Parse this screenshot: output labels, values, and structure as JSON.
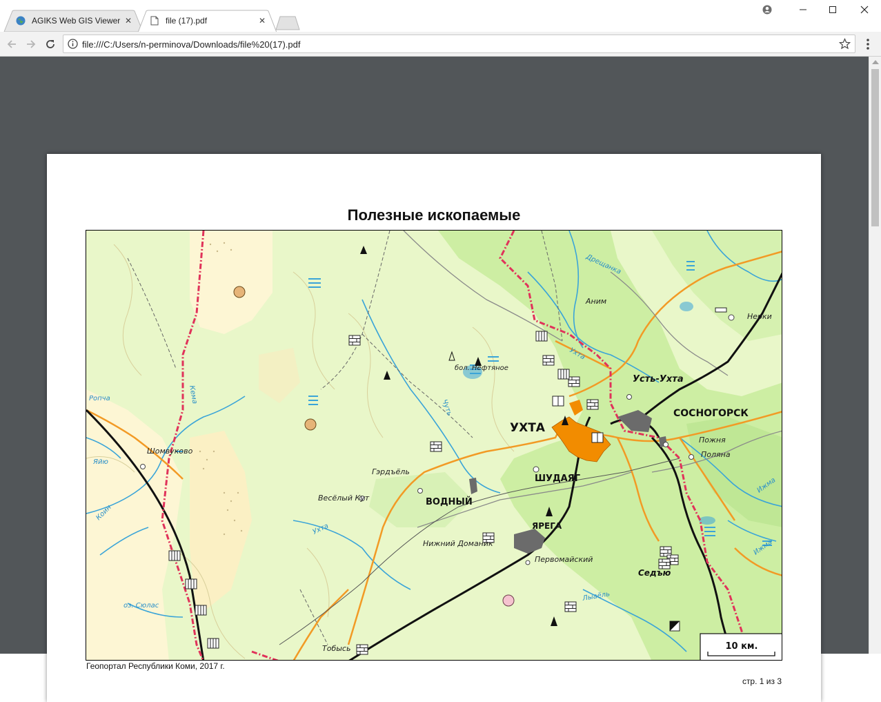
{
  "browser": {
    "tabs": [
      {
        "title": "AGIKS Web GIS Viewer",
        "active": false,
        "favicon": "globe-icon"
      },
      {
        "title": "file (17).pdf",
        "active": true,
        "favicon": "document-icon"
      }
    ],
    "url": "file:///C:/Users/n-perminova/Downloads/file%20(17).pdf"
  },
  "document": {
    "title": "Полезные ископаемые",
    "caption": "Геопортал Республики Коми, 2017 г.",
    "page_indicator": "стр. 1 из 3"
  },
  "map": {
    "scale_label": "10 км.",
    "labels": {
      "ukhta": "УХТА",
      "sosnogorsk": "СОСНОГОРСК",
      "shudayag": "ШУДАЯГ",
      "vodny": "ВОДНЫЙ",
      "yarega": "ЯРЕГА",
      "sedyu": "Седъю",
      "ust_ukhta": "Усть-Ухта",
      "anim": "Аним",
      "nerki": "Нерки",
      "pozhnya": "Пожня",
      "polyana": "Поляна",
      "shomvukovo": "Шомвуково",
      "gerdyel": "Гэрдъёль",
      "vesely_kut": "Весёлый Кут",
      "nizhny_domanik": "Нижний Доманик",
      "pervomaysky": "Первомайский",
      "tobys": "Тобысь",
      "boloto": "бол. Нефтяное",
      "lake_syulas": "оз. Сюлас",
      "river_ukhta": "Ухта",
      "river_ukhta2": "Ухта",
      "river_chut": "Чуть",
      "river_koin": "Коин",
      "river_yayu": "Яйю",
      "river_ropcha": "Ропча",
      "river_kema": "Кема",
      "river_lyaelya": "Лыаёль",
      "river_izhma": "Ижма",
      "river_izhma2": "Ижма",
      "river_dreshchanka": "Дрещанка"
    },
    "colors": {
      "land": "#e9f7c9",
      "forest": "#cdeea3",
      "sand": "#fdf6d4",
      "river": "#3aa4d8",
      "road": "#f29a25",
      "rail": "#111111",
      "border": "#e0325a",
      "city": "#f28c00",
      "industrial": "#6b6b6b"
    }
  }
}
